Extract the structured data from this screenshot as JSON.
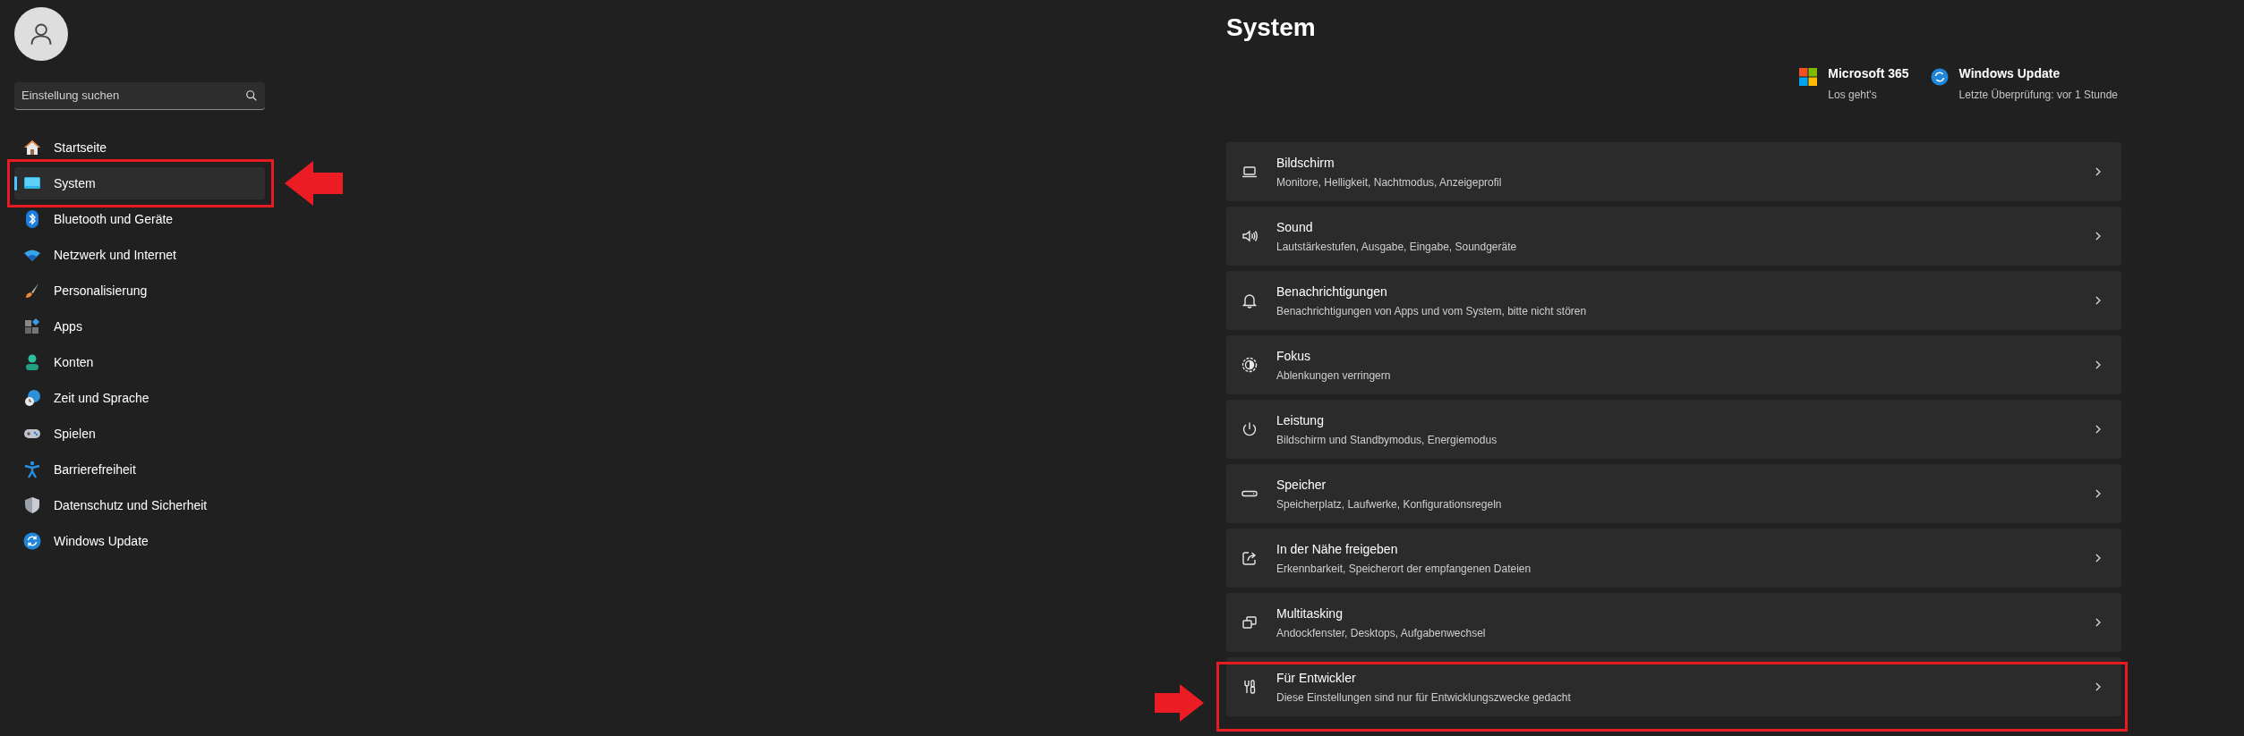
{
  "search": {
    "placeholder": "Einstellung suchen"
  },
  "sidebar": {
    "items": [
      {
        "label": "Startseite",
        "selected": false
      },
      {
        "label": "System",
        "selected": true
      },
      {
        "label": "Bluetooth und Geräte",
        "selected": false
      },
      {
        "label": "Netzwerk und Internet",
        "selected": false
      },
      {
        "label": "Personalisierung",
        "selected": false
      },
      {
        "label": "Apps",
        "selected": false
      },
      {
        "label": "Konten",
        "selected": false
      },
      {
        "label": "Zeit und Sprache",
        "selected": false
      },
      {
        "label": "Spielen",
        "selected": false
      },
      {
        "label": "Barrierefreiheit",
        "selected": false
      },
      {
        "label": "Datenschutz und Sicherheit",
        "selected": false
      },
      {
        "label": "Windows Update",
        "selected": false
      }
    ]
  },
  "page_title": "System",
  "header_links": [
    {
      "title": "Microsoft 365",
      "subtitle": "Los geht's"
    },
    {
      "title": "Windows Update",
      "subtitle": "Letzte Überprüfung: vor 1 Stunde"
    }
  ],
  "settings": [
    {
      "title": "Bildschirm",
      "subtitle": "Monitore, Helligkeit, Nachtmodus, Anzeigeprofil"
    },
    {
      "title": "Sound",
      "subtitle": "Lautstärkestufen, Ausgabe, Eingabe, Soundgeräte"
    },
    {
      "title": "Benachrichtigungen",
      "subtitle": "Benachrichtigungen von Apps und vom System, bitte nicht stören"
    },
    {
      "title": "Fokus",
      "subtitle": "Ablenkungen verringern"
    },
    {
      "title": "Leistung",
      "subtitle": "Bildschirm und Standbymodus, Energiemodus"
    },
    {
      "title": "Speicher",
      "subtitle": "Speicherplatz, Laufwerke, Konfigurationsregeln"
    },
    {
      "title": "In der Nähe freigeben",
      "subtitle": "Erkennbarkeit, Speicherort der empfangenen Dateien"
    },
    {
      "title": "Multitasking",
      "subtitle": "Andockfenster, Desktops, Aufgabenwechsel"
    },
    {
      "title": "Für Entwickler",
      "subtitle": "Diese Einstellungen sind nur für Entwicklungszwecke gedacht"
    }
  ]
}
